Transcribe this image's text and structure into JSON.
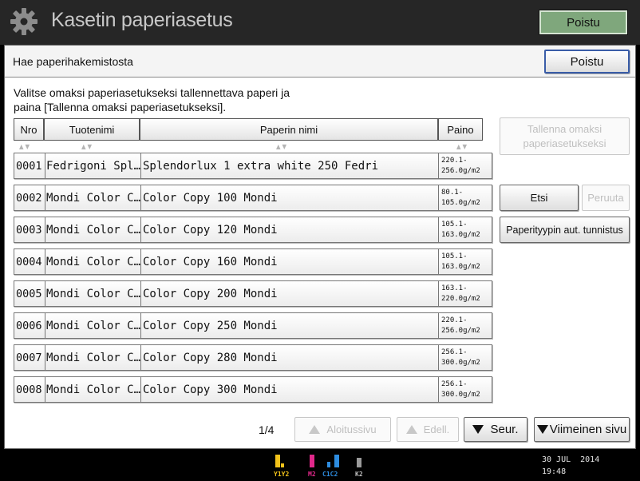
{
  "titlebar": {
    "title": "Kasetin paperiasetus",
    "exit_label": "Poistu"
  },
  "panel": {
    "header": "Hae paperihakemistosta",
    "exit_label": "Poistu",
    "instruction_line1": "Valitse omaksi paperiasetukseksi tallennettava paperi ja",
    "instruction_line2": "paina [Tallenna omaksi paperiasetukseksi]."
  },
  "table": {
    "headers": {
      "nro": "Nro",
      "product": "Tuotenimi",
      "name": "Paperin nimi",
      "weight": "Paino"
    },
    "rows": [
      {
        "nro": "0001",
        "product": "Fedrigoni Spl…",
        "name": "Splendorlux 1 extra white 250 Fedri",
        "w1": "220.1-",
        "w2": "256.0g/m2"
      },
      {
        "nro": "0002",
        "product": "Mondi Color C…",
        "name": "Color Copy 100 Mondi",
        "w1": "80.1-",
        "w2": "105.0g/m2"
      },
      {
        "nro": "0003",
        "product": "Mondi Color C…",
        "name": "Color Copy 120 Mondi",
        "w1": "105.1-",
        "w2": "163.0g/m2"
      },
      {
        "nro": "0004",
        "product": "Mondi Color C…",
        "name": "Color Copy 160 Mondi",
        "w1": "105.1-",
        "w2": "163.0g/m2"
      },
      {
        "nro": "0005",
        "product": "Mondi Color C…",
        "name": "Color Copy 200 Mondi",
        "w1": "163.1-",
        "w2": "220.0g/m2"
      },
      {
        "nro": "0006",
        "product": "Mondi Color C…",
        "name": "Color Copy 250 Mondi",
        "w1": "220.1-",
        "w2": "256.0g/m2"
      },
      {
        "nro": "0007",
        "product": "Mondi Color C…",
        "name": "Color Copy 280 Mondi",
        "w1": "256.1-",
        "w2": "300.0g/m2"
      },
      {
        "nro": "0008",
        "product": "Mondi Color C…",
        "name": "Color Copy 300 Mondi",
        "w1": "256.1-",
        "w2": "300.0g/m2"
      }
    ]
  },
  "side": {
    "save_line1": "Tallenna omaksi",
    "save_line2": "paperiasetukseksi",
    "search": "Etsi",
    "cancel": "Peruuta",
    "auto_detect": "Paperityypin aut. tunnistus"
  },
  "pager": {
    "page": "1/4",
    "first": "Aloitussivu",
    "prev": "Edell.",
    "next": "Seur.",
    "last": "Viimeinen sivu"
  },
  "status": {
    "toners": [
      {
        "label": "Y1Y2",
        "color": "#f2c21a"
      },
      {
        "label": "M2",
        "color": "#e0288a"
      },
      {
        "label": "C1C2",
        "color": "#2e8de0"
      },
      {
        "label": "K2",
        "color": "#9a9a9a"
      }
    ],
    "date": "30 JUL  2014",
    "time": "19:48"
  }
}
